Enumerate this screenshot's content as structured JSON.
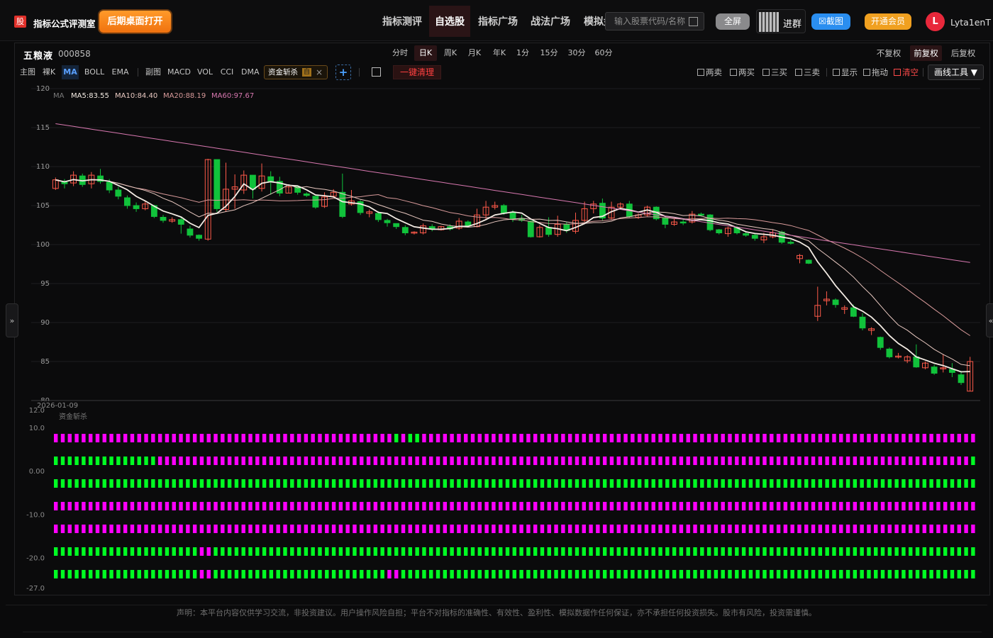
{
  "header": {
    "logo_glyph": "股",
    "brand": "指标公式评测室",
    "open_desktop": "后期桌面打开",
    "nav": [
      "指标测评",
      "自选股",
      "指标广场",
      "战法广场",
      "模拟盘"
    ],
    "active_nav": "自选股",
    "search_placeholder": "输入股票代码/名称",
    "fullscreen": "全屏",
    "join_group": "进群",
    "screenshot": "☒截图",
    "membership": "开通会员",
    "avatar_letter": "L",
    "username": "Lyta1enT"
  },
  "stock": {
    "name": "五粮液",
    "code": "000858"
  },
  "periods": [
    "分时",
    "日K",
    "周K",
    "月K",
    "年K",
    "1分",
    "15分",
    "30分",
    "60分"
  ],
  "active_period": "日K",
  "adjust": [
    "不复权",
    "前复权",
    "后复权"
  ],
  "active_adjust": "前复权",
  "indicator_bar": {
    "main_label": "主图",
    "naked_k": "裸K",
    "ma": "MA",
    "boll": "BOLL",
    "ema": "EMA",
    "sub_label": "副图",
    "macd": "MACD",
    "vol": "VOL",
    "cci": "CCI",
    "dma": "DMA",
    "chip_name": "资金斩杀",
    "chip_tag": "自",
    "chip_close": "×",
    "add": "+",
    "clear_all": "一键清理"
  },
  "tools": {
    "two_sell": "两卖",
    "two_buy": "两买",
    "three_buy": "三买",
    "three_sell": "三卖",
    "show": "显示",
    "drag": "拖动",
    "clear": "清空",
    "draw_tools": "画线工具 ▼"
  },
  "colors": {
    "up": "#ff5a4a",
    "down": "#11c23b",
    "ma5": "#f4ece4",
    "ma10": "#e8c8c0",
    "ma20": "#d89a9a",
    "ma60": "#d878b0",
    "magenta": "#ff00ff",
    "green": "#00ff22"
  },
  "chart_data": [
    {
      "type": "candlestick",
      "title": "",
      "legend": {
        "label": "MA",
        "items": [
          {
            "name": "MA5",
            "value": "MA5:83.55",
            "color": "#f4ece4"
          },
          {
            "name": "MA10",
            "value": "MA10:84.40",
            "color": "#e8c8c0"
          },
          {
            "name": "MA20",
            "value": "MA20:88.19",
            "color": "#d89a9a"
          },
          {
            "name": "MA60",
            "value": "MA60:97.67",
            "color": "#d878b0"
          }
        ]
      },
      "y_ticks": [
        120,
        115,
        110,
        105,
        100,
        95,
        90,
        85,
        80
      ],
      "ylim": [
        80,
        120
      ],
      "x_label_first_date": "2026-01-09",
      "grid": true,
      "candles": [
        [
          107.2,
          108.3,
          107.0,
          108.6
        ],
        [
          108.0,
          107.8,
          107.2,
          108.4
        ],
        [
          107.9,
          108.9,
          107.5,
          109.4
        ],
        [
          108.8,
          107.7,
          107.4,
          109.1
        ],
        [
          107.8,
          108.9,
          107.2,
          109.3
        ],
        [
          108.8,
          108.1,
          107.8,
          109.7
        ],
        [
          108.0,
          107.0,
          106.6,
          108.4
        ],
        [
          107.0,
          106.2,
          105.8,
          107.4
        ],
        [
          106.0,
          105.0,
          104.6,
          106.3
        ],
        [
          105.0,
          104.6,
          104.2,
          105.4
        ],
        [
          104.6,
          105.2,
          104.4,
          105.5
        ],
        [
          105.0,
          103.6,
          103.4,
          105.1
        ],
        [
          103.5,
          103.1,
          102.8,
          103.8
        ],
        [
          103.0,
          103.2,
          102.8,
          103.5
        ],
        [
          103.2,
          102.6,
          101.4,
          103.5
        ],
        [
          102.0,
          101.2,
          100.9,
          102.4
        ],
        [
          101.2,
          100.8,
          100.5,
          101.3
        ],
        [
          100.7,
          110.9,
          100.5,
          111.0
        ],
        [
          110.9,
          104.6,
          104.2,
          110.9
        ],
        [
          104.5,
          107.1,
          104.2,
          110.5
        ],
        [
          107.1,
          107.4,
          104.6,
          109.0
        ],
        [
          107.0,
          108.9,
          106.5,
          109.5
        ],
        [
          108.9,
          107.1,
          105.9,
          108.4
        ],
        [
          107.2,
          108.8,
          106.8,
          110.4
        ],
        [
          108.7,
          108.1,
          106.4,
          109.4
        ],
        [
          108.1,
          106.6,
          106.2,
          108.7
        ],
        [
          106.6,
          107.4,
          106.6,
          107.7
        ],
        [
          107.4,
          106.7,
          106.4,
          107.4
        ],
        [
          106.5,
          106.3,
          106.1,
          106.7
        ],
        [
          106.2,
          104.8,
          104.6,
          106.2
        ],
        [
          104.9,
          106.1,
          104.7,
          106.7
        ],
        [
          106.2,
          106.7,
          106.0,
          107.1
        ],
        [
          106.7,
          103.6,
          103.4,
          109.1
        ],
        [
          105.2,
          105.6,
          105.0,
          107.0
        ],
        [
          105.5,
          104.1,
          103.8,
          105.7
        ],
        [
          104.0,
          104.2,
          103.5,
          104.5
        ],
        [
          104.0,
          103.2,
          102.9,
          104.3
        ],
        [
          103.1,
          102.8,
          102.3,
          103.3
        ],
        [
          102.7,
          102.3,
          102.0,
          102.7
        ],
        [
          102.2,
          101.5,
          101.2,
          102.5
        ],
        [
          101.5,
          101.6,
          101.3,
          101.7
        ],
        [
          101.5,
          102.4,
          101.3,
          102.7
        ],
        [
          102.3,
          102.0,
          101.7,
          102.6
        ],
        [
          101.9,
          102.3,
          101.8,
          102.4
        ],
        [
          102.3,
          102.0,
          101.8,
          102.6
        ],
        [
          102.1,
          103.0,
          101.9,
          103.4
        ],
        [
          102.9,
          102.4,
          102.2,
          103.1
        ],
        [
          102.3,
          103.8,
          102.2,
          104.6
        ],
        [
          103.8,
          104.8,
          103.2,
          105.6
        ],
        [
          104.8,
          105.0,
          104.5,
          105.5
        ],
        [
          105.0,
          104.0,
          103.8,
          105.2
        ],
        [
          104.1,
          103.3,
          102.9,
          104.4
        ],
        [
          103.3,
          103.1,
          102.9,
          103.8
        ],
        [
          103.0,
          101.0,
          100.9,
          103.1
        ],
        [
          101.0,
          102.2,
          100.9,
          102.5
        ],
        [
          102.2,
          101.3,
          101.0,
          103.5
        ],
        [
          101.3,
          102.6,
          101.0,
          103.7
        ],
        [
          102.6,
          101.8,
          101.5,
          102.9
        ],
        [
          101.7,
          103.1,
          101.4,
          104.1
        ],
        [
          103.1,
          104.6,
          102.9,
          105.5
        ],
        [
          104.6,
          105.2,
          104.0,
          105.6
        ],
        [
          105.3,
          103.4,
          103.1,
          105.9
        ],
        [
          103.4,
          104.8,
          103.2,
          105.5
        ],
        [
          104.8,
          105.2,
          104.6,
          105.4
        ],
        [
          105.2,
          103.6,
          103.4,
          105.6
        ],
        [
          103.5,
          103.8,
          103.3,
          104.0
        ],
        [
          103.8,
          104.8,
          103.6,
          105.0
        ],
        [
          104.8,
          103.3,
          103.1,
          104.9
        ],
        [
          103.4,
          102.6,
          102.1,
          103.6
        ],
        [
          102.6,
          102.9,
          102.4,
          103.3
        ],
        [
          102.9,
          102.8,
          102.5,
          103.2
        ],
        [
          102.9,
          103.9,
          102.7,
          104.3
        ],
        [
          103.9,
          103.8,
          103.6,
          104.1
        ],
        [
          103.8,
          101.9,
          101.7,
          103.9
        ],
        [
          101.9,
          101.5,
          101.3,
          102.0
        ],
        [
          101.4,
          102.1,
          101.0,
          102.3
        ],
        [
          102.2,
          101.5,
          101.3,
          102.4
        ],
        [
          101.4,
          101.2,
          101.0,
          101.6
        ],
        [
          101.2,
          100.8,
          100.5,
          101.4
        ],
        [
          100.6,
          101.0,
          100.2,
          101.5
        ],
        [
          101.0,
          101.5,
          100.8,
          101.9
        ],
        [
          101.6,
          100.3,
          100.1,
          101.8
        ],
        [
          100.3,
          100.2,
          100.0,
          100.6
        ],
        [
          98.2,
          98.6,
          97.6,
          98.8
        ],
        [
          98.0,
          97.6,
          97.5,
          98.1
        ],
        [
          90.8,
          92.2,
          90.2,
          94.6
        ],
        [
          92.8,
          93.0,
          92.2,
          94.0
        ],
        [
          92.9,
          92.3,
          91.9,
          93.1
        ],
        [
          91.7,
          91.9,
          91.1,
          92.2
        ],
        [
          91.9,
          90.8,
          90.7,
          92.3
        ],
        [
          90.7,
          89.3,
          89.0,
          91.2
        ],
        [
          89.0,
          89.2,
          88.4,
          89.4
        ],
        [
          88.1,
          86.8,
          86.5,
          88.2
        ],
        [
          86.6,
          85.6,
          85.4,
          86.8
        ],
        [
          85.6,
          85.7,
          85.4,
          86.1
        ],
        [
          85.1,
          85.6,
          84.8,
          85.8
        ],
        [
          85.6,
          84.3,
          84.2,
          87.2
        ],
        [
          84.2,
          84.8,
          84.0,
          85.0
        ],
        [
          84.3,
          83.5,
          83.3,
          84.6
        ],
        [
          84.1,
          84.2,
          83.6,
          85.9
        ],
        [
          84.0,
          83.6,
          83.0,
          84.8
        ],
        [
          83.3,
          82.3,
          82.0,
          83.8
        ],
        [
          81.2,
          85.0,
          81.2,
          85.6
        ]
      ]
    },
    {
      "type": "bar",
      "title": "资金斩杀",
      "y_ticks": [
        "12.0",
        "10.0",
        "0.00",
        "-10.0",
        "-20.0",
        "-27.0"
      ],
      "ylim": [
        -27,
        12
      ],
      "rows": [
        {
          "level": 10.0,
          "pattern": "MMMMMMMMMMMMMMMMMMMMMMMMMMMMMMMMMMMMMMMMMMMMMMMMMGMGGMMMMMMMMMMMMMMMMMMMMMMMMMMMMMMMMMMMMMMMMMMMMMMMMMMMMMMMMMMMMMMMMMMMMMMMMMMMMMMMM"
        },
        {
          "level": 5.0,
          "pattern": "GGGGGGGGGGGGGGGMMMMMMMMMMMMMMMMMMMMMMMMMMMMMMMMMMMMMMMMMMMMMMMMMMMMMMMMMMMMMMMMMMMMMMMMMMMMMMMMMMMMMMMMMMMMMMMMMMMMMMMMMMMMMMMMMMMMM"
        },
        {
          "level": 0.0,
          "pattern": "GGGGGGGGGGGGGGGGGGGGGGGGGGGGGGGGGGGGGGGGGGGGGGGGGGGGGGGGGGGGGGGGGGGGGGGGGGGGGGGGGGGGGGGGGGGGGGGGGGGGGGGGGGGGGGGGGGGGGGGGGGGGGGGGGGGGG"
        },
        {
          "level": -5.0,
          "pattern": "MMMMMMMMMMMMMMMMMMMMMMMMMMMMMMMMMMMMMMMMMMMMMMMMMMMMMMMMMMMMMMMMMMMMMMMMMMMMMMMMMMMMMMMMMMMMMMMMMMMMMMMMMMMMMMMMMMMMMMMMMMMMMMMMMMMMMM"
        },
        {
          "level": -10.0,
          "pattern": "MMMMMMMMMMMMMMMMMMMMMMMMMMMMMMMMMMMMMMMMMMMMMMMMMMMMMMMMMMMMMMMMMMMMMMMMMMMMMMMMMMMMMMMMMMMMMMMMMMMMMMMMMMMMMMMMMMMMMMMMMMMMMMMMMMMMMM"
        },
        {
          "level": -15.0,
          "pattern": "GGGGGGGGGGGGGGGGGGGGGMMGGGGGGGGGGGGGGGGGGGGGGGGGGGGGGGGGGGGGGGGGGGGGGGGGGGGGGGGGGGGGGGGGGGGGGGGGGGGGGGGGGGGGGGGGGGGGGGGGGGGGGGGGGGGG"
        },
        {
          "level": -20.0,
          "pattern": "GGGGGGGGGGGGGGGGGGGGGMMGGGGGGGGGGGGGGGGGGGGGGGGGMMGGGGGGGGGGGGGGGGGGGGGGGGGGGGGGGGGGGGGGGGGGGGGGGGGGGGGGGGGGGGGGGGGGGGGGGGGGGGGGGGG"
        }
      ]
    }
  ],
  "footer": "声明：本平台内容仅供学习交流，非投资建议。用户操作风险自担；平台不对指标的准确性、有效性、盈利性、模拟数据作任何保证，亦不承担任何投资损失。股市有风险，投资需谨慎。"
}
